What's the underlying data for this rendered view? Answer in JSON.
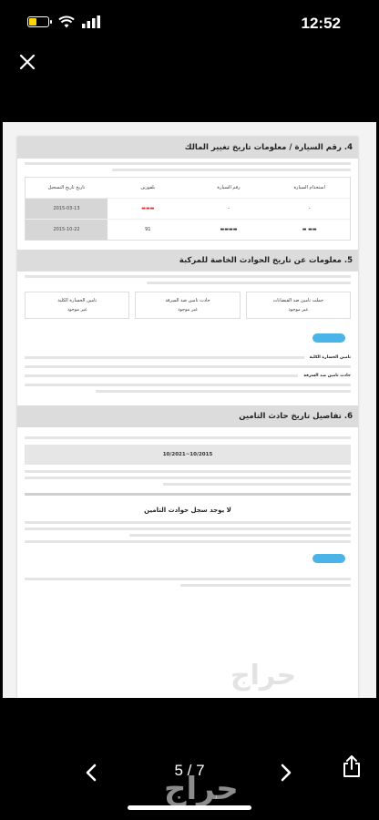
{
  "status_bar": {
    "time": "12:52",
    "battery_color": "#ffd60a"
  },
  "viewer": {
    "page_indicator": "5 / 7"
  },
  "document": {
    "section4": {
      "title": "4. رقم السيارة / معلومات تاريخ تغيير المالك",
      "columns": [
        "استخدام السيارة",
        "رقم السيارة",
        "بلفورين",
        "تاريخ تاريخ التسجيل"
      ],
      "rows": [
        [
          "-",
          "-",
          "",
          "2015-03-13"
        ],
        [
          "",
          "",
          "91",
          "2015-10-22"
        ]
      ]
    },
    "section5": {
      "title": "5. معلومات عن تاريخ الحوادث الخاصة للمركبة",
      "cards": [
        {
          "label": "حملت تامين ضد الفيضانات",
          "value": "غير موجود"
        },
        {
          "label": "حادث تامين ضد السرقة",
          "value": "غير موجود"
        },
        {
          "label": "تامين الخسارة الكلية",
          "value": "غير موجود"
        }
      ],
      "labels": [
        "تامين الخسارة الكلية",
        "حادث تامين ضد السرقة"
      ]
    },
    "section6": {
      "title": "6. تفاصيل تاريخ حادث التامين",
      "date_range": "10/2021~10/2015",
      "no_record": "لا يوجد سجل حوادث التامين"
    }
  },
  "watermark": "حراج",
  "accent_color": "#4ab3e8",
  "icons": [
    "battery-icon",
    "wifi-icon",
    "signal-icon",
    "close-icon",
    "chevron-left-icon",
    "chevron-right-icon",
    "share-icon"
  ]
}
